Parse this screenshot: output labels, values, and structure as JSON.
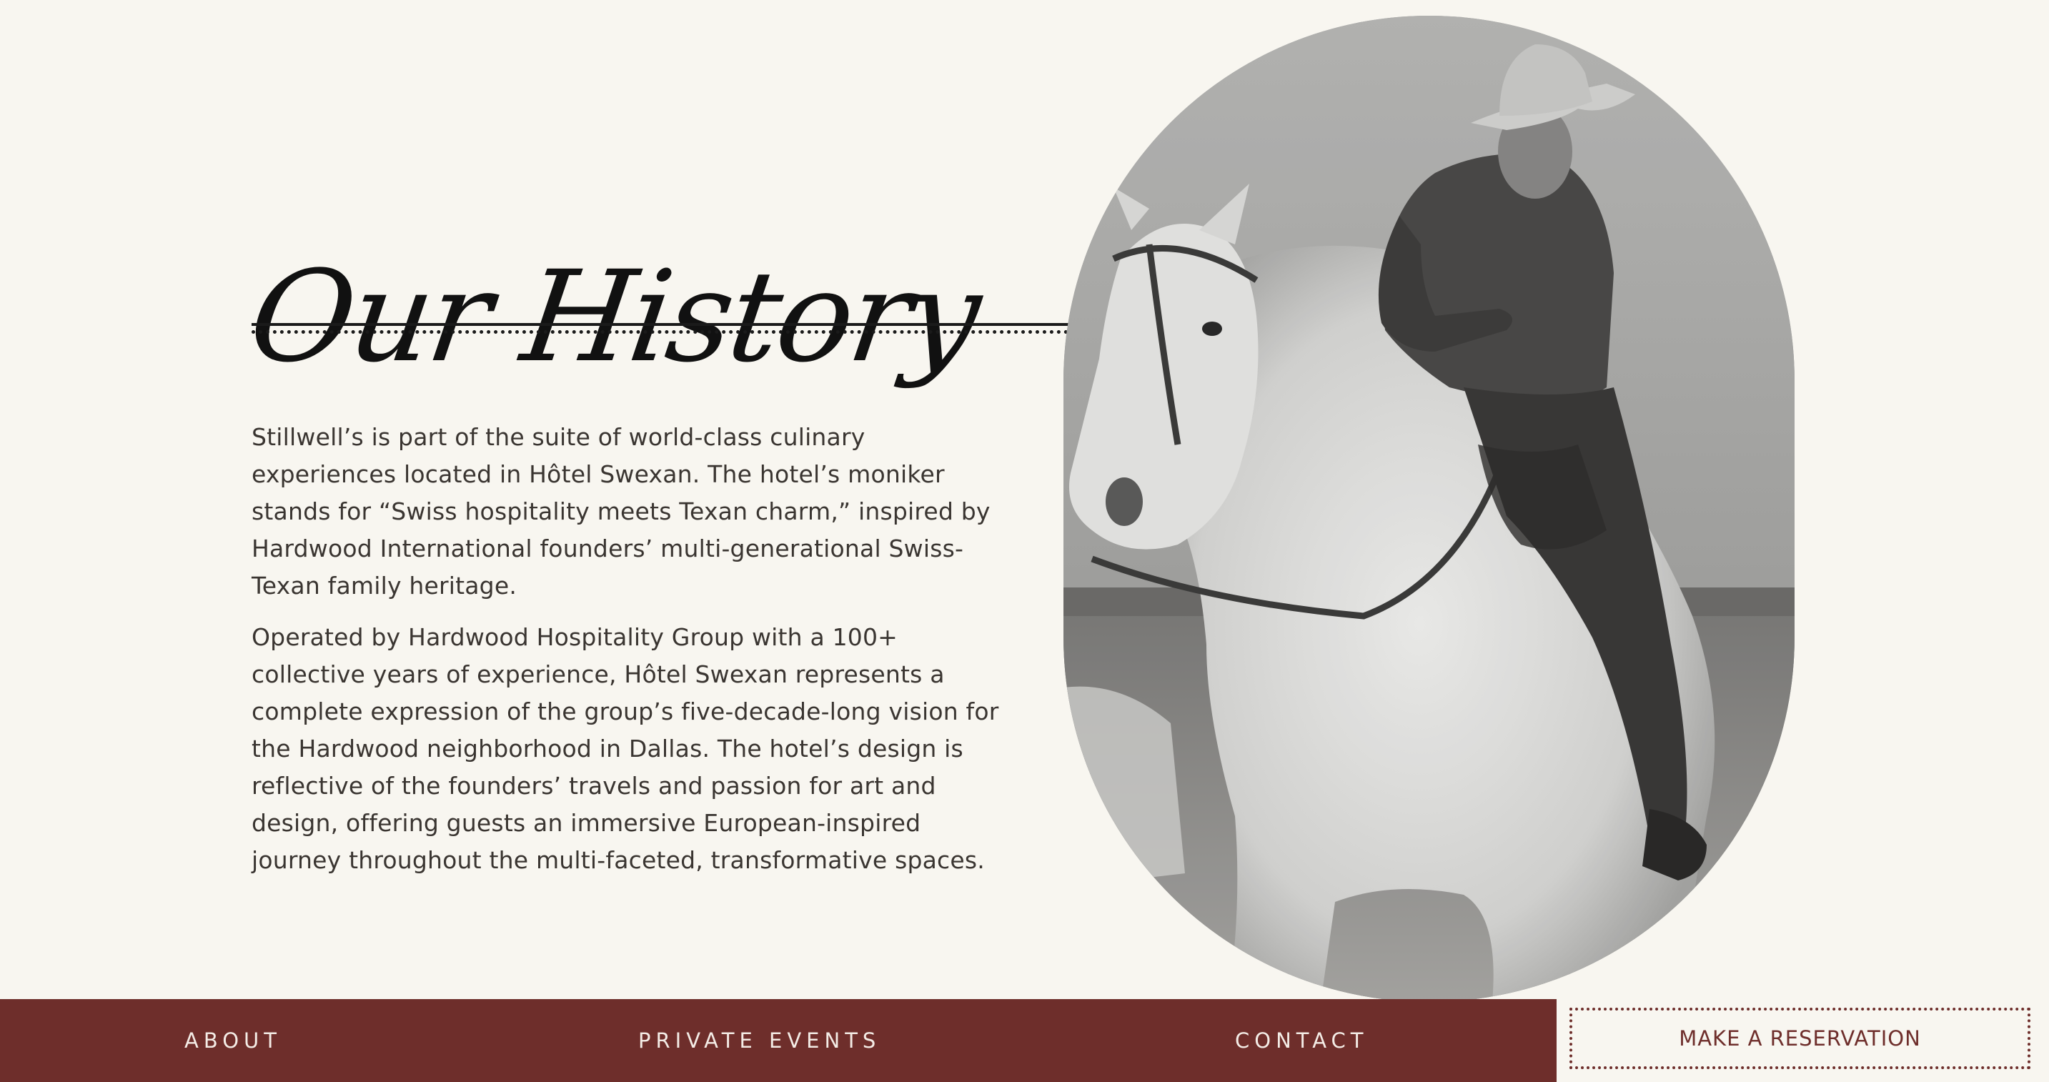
{
  "section": {
    "title": "Our History",
    "paragraphs": [
      "Stillwell’s is part of the suite of world-class culinary experiences located in Hôtel Swexan. The hotel’s moniker stands for “Swiss hospitality meets Texan charm,” inspired by Hardwood International founders’ multi-generational Swiss-Texan family heritage.",
      "Operated by Hardwood Hospitality Group with a 100+ collective years of experience, Hôtel Swexan represents a complete expression of the group’s five-decade-long vision for the Hardwood neighborhood in Dallas. The hotel’s design is reflective of the founders’ travels and passion for art and design, offering guests an immersive European-inspired journey throughout the multi-faceted, transformative spaces."
    ]
  },
  "nav": {
    "about": "ABOUT",
    "private_events": "PRIVATE EVENTS",
    "contact": "CONTACT",
    "reservation": "MAKE A RESERVATION"
  },
  "colors": {
    "background": "#f8f6f0",
    "nav_background": "#6e2e2b",
    "nav_text": "#f4ece6",
    "accent": "#6e2e2b"
  }
}
